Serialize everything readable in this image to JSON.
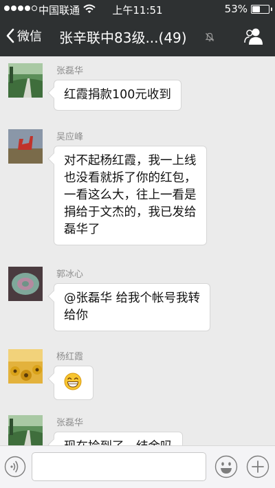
{
  "status_bar": {
    "signal_filled": 4,
    "signal_total": 5,
    "carrier": "中国联通",
    "time": "上午11:51",
    "battery_percent": "53%",
    "battery_level": 0.53
  },
  "nav": {
    "back_label": "微信",
    "title": "张辛联中83级...(49)",
    "icons": [
      "chevron-left-icon",
      "mute-icon",
      "group-members-icon"
    ]
  },
  "messages": [
    {
      "sender": "张磊华",
      "lines": [
        "红霞捐款100元收到"
      ]
    },
    {
      "sender": "吴应峰",
      "lines": [
        "对不起杨红霞，我一上线",
        "也没看就拆了你的红包，",
        "一看这么大，往上一看是",
        "捐给于文杰的，我已发给",
        "磊华了"
      ]
    },
    {
      "sender": "郭冰心",
      "lines": [
        "@张磊华 给我个帐号我转",
        "给你"
      ]
    },
    {
      "sender": "杨红霞",
      "lines": [],
      "emoji": "grinning-face-emoji"
    },
    {
      "sender": "张磊华",
      "lines": [
        "现在捡到了，结余吗"
      ]
    }
  ],
  "input_bar": {
    "value": "",
    "icons": [
      "voice-icon",
      "emoji-icon",
      "plus-icon"
    ]
  },
  "colors": {
    "nav_background": "#2e3132",
    "chat_background": "#ebebeb",
    "bubble_background": "#ffffff",
    "sender_name": "#8e8e8e"
  }
}
